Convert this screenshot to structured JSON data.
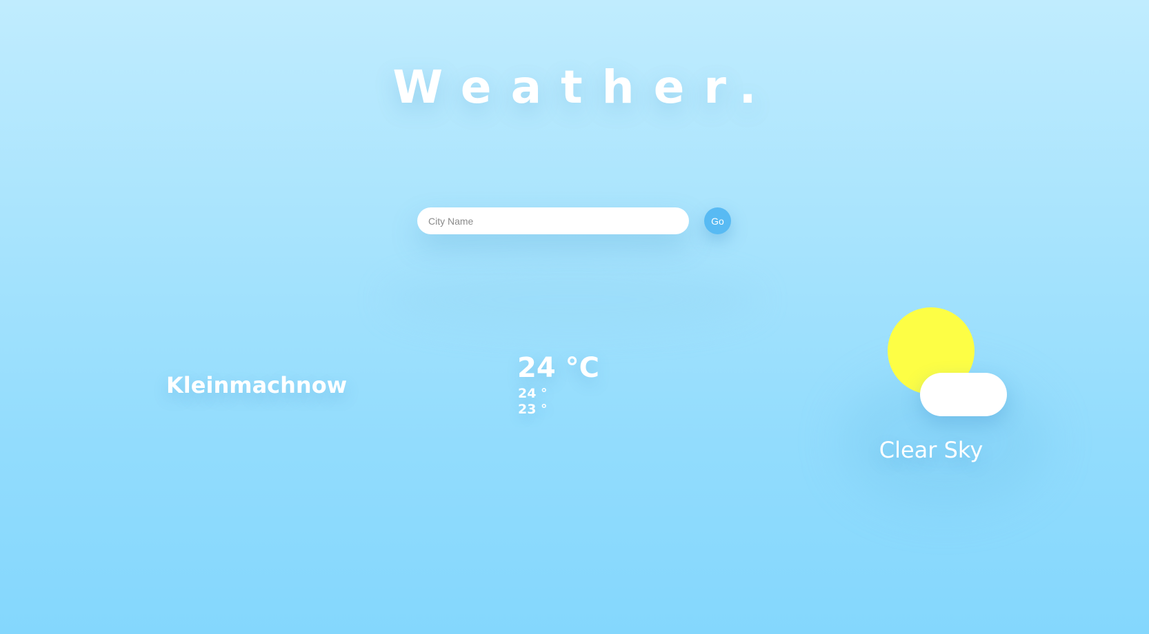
{
  "header": {
    "title": "Weather."
  },
  "search": {
    "placeholder": "City Name",
    "value": "",
    "button_label": "Go"
  },
  "current": {
    "city": "Kleinmachnow",
    "temperature": "24 °C",
    "temp_max": "24 °",
    "temp_min": "23 °",
    "condition": "Clear Sky",
    "icon": "sun-cloud-icon"
  },
  "colors": {
    "background_top": "#c0ecfe",
    "background_bottom": "#84d7fd",
    "button": "#58baf3",
    "sun": "#fdfe45",
    "cloud": "#ffffff",
    "text": "#ffffff"
  }
}
